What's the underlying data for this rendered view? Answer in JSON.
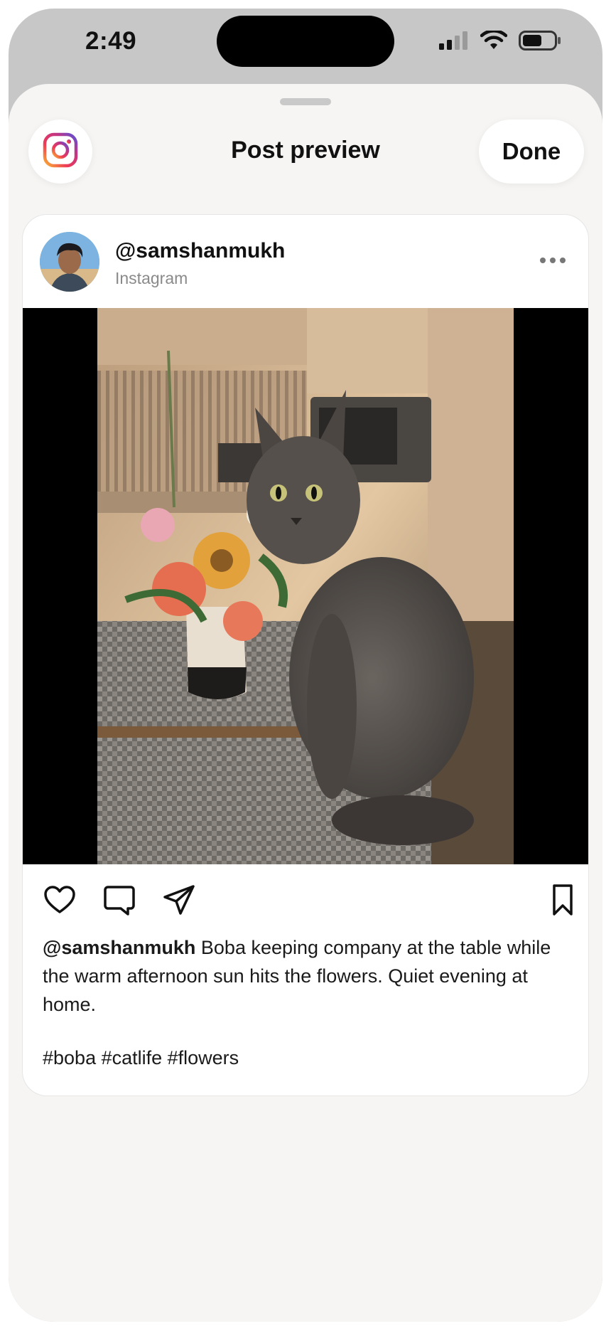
{
  "status_bar": {
    "time": "2:49",
    "icons": [
      "cellular-signal-icon",
      "wifi-icon",
      "battery-icon"
    ]
  },
  "header": {
    "title": "Post preview",
    "done_label": "Done",
    "app_icon": "instagram-logo"
  },
  "post": {
    "username": "@samshanmukh",
    "source": "Instagram",
    "caption_username": "@samshanmukh",
    "caption_text": " Boba keeping company at the table while the warm afternoon sun hits the flowers. Quiet evening at home.",
    "hashtags": "#boba #catlife #flowers",
    "image_description": "gray cat sitting on a table next to a vase of flowers in a sunlit kitchen",
    "actions": [
      "heart-icon",
      "comment-icon",
      "share-icon",
      "bookmark-icon"
    ]
  },
  "colors": {
    "sheet_background": "#f6f5f3",
    "card_background": "#ffffff",
    "muted_text": "#8a8a8a",
    "phone_frame": "#c7c7c7"
  }
}
